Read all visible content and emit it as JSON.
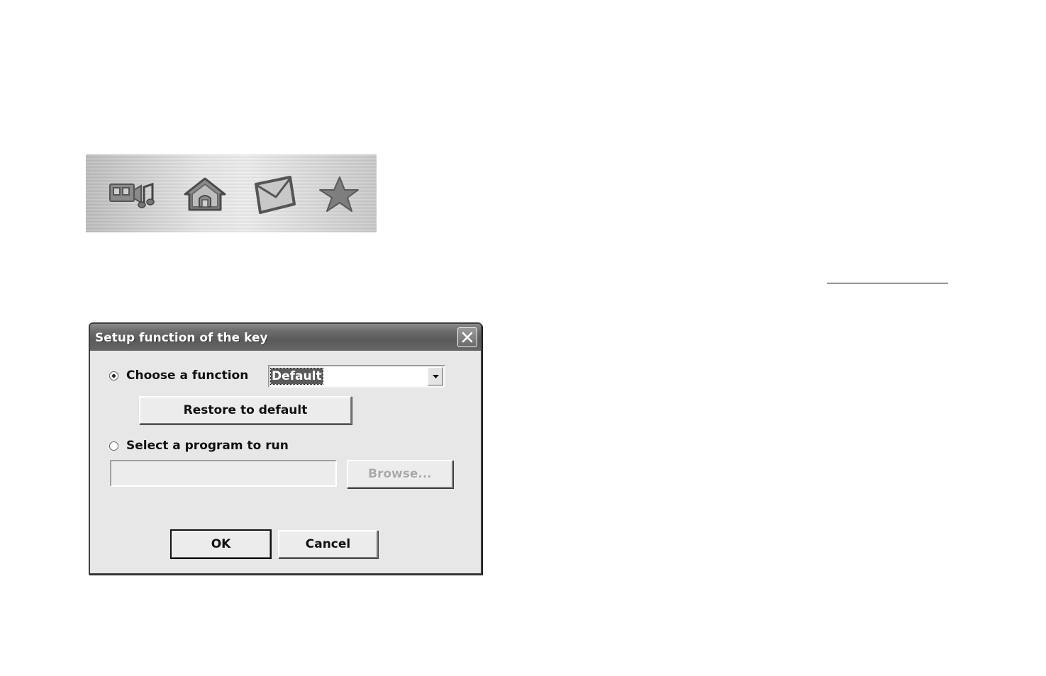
{
  "hotkeys": [
    {
      "icon": "multimedia-icon"
    },
    {
      "icon": "home-icon"
    },
    {
      "icon": "mail-icon"
    },
    {
      "icon": "favorites-star-icon"
    }
  ],
  "dialog": {
    "title": "Setup function of the key",
    "close_icon": "close-icon",
    "option_function": {
      "label": "Choose a function",
      "selected": true,
      "dropdown_value": "Default"
    },
    "restore_button": "Restore to default",
    "option_program": {
      "label": "Select a program to run",
      "selected": false,
      "path_value": ""
    },
    "browse_button": "Browse...",
    "ok_button": "OK",
    "cancel_button": "Cancel"
  },
  "colors": {
    "title_bar": "#6e6e6e",
    "dialog_background": "#e7e7e7",
    "selection_highlight": "#5a5a5a"
  }
}
